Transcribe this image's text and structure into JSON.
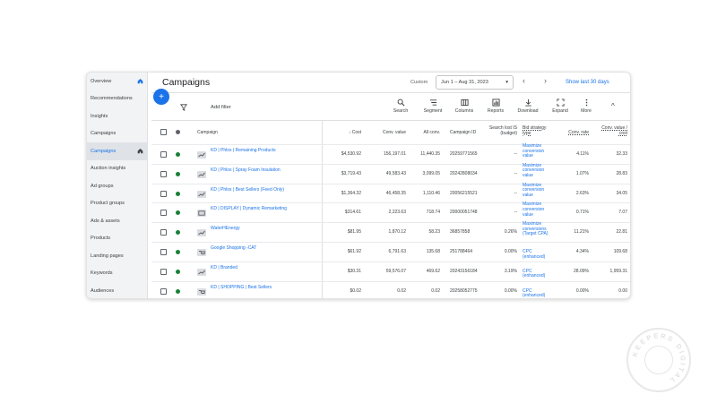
{
  "sidebar": {
    "items": [
      {
        "label": "Overview",
        "home": true,
        "active": false
      },
      {
        "label": "Recommendations",
        "home": false,
        "active": false
      },
      {
        "label": "Insights",
        "home": false,
        "active": false
      },
      {
        "label": "Campaigns",
        "home": false,
        "active": false
      },
      {
        "label": "Campaigns",
        "home": true,
        "active": true
      },
      {
        "label": "Auction insights",
        "home": false,
        "active": false
      },
      {
        "label": "Ad groups",
        "home": false,
        "active": false
      },
      {
        "label": "Product groups",
        "home": false,
        "active": false
      },
      {
        "label": "Ads & assets",
        "home": false,
        "active": false
      },
      {
        "label": "Products",
        "home": false,
        "active": false
      },
      {
        "label": "Landing pages",
        "home": false,
        "active": false
      },
      {
        "label": "Keywords",
        "home": false,
        "active": false
      },
      {
        "label": "Audiences",
        "home": false,
        "active": false
      }
    ]
  },
  "header": {
    "title": "Campaigns",
    "custom_label": "Custom",
    "date_range": "Jun 1 – Aug 31, 2023",
    "show_last": "Show last 30 days"
  },
  "toolbar": {
    "fab": "+",
    "add_filter": "Add filter",
    "tools": [
      {
        "label": "Search",
        "icon": "search-icon"
      },
      {
        "label": "Segment",
        "icon": "segment-icon"
      },
      {
        "label": "Columns",
        "icon": "columns-icon"
      },
      {
        "label": "Reports",
        "icon": "reports-icon"
      },
      {
        "label": "Download",
        "icon": "download-icon"
      },
      {
        "label": "Expand",
        "icon": "expand-icon"
      },
      {
        "label": "More",
        "icon": "more-icon"
      }
    ],
    "collapse": "^"
  },
  "table": {
    "headers": {
      "campaign": "Campaign",
      "cost": "↓ Cost",
      "conv_value": "Conv. value",
      "all_conv": "All conv.",
      "campaign_id": "Campaign ID",
      "search_lost_is": "Search lost IS (budget)",
      "bid_strategy": "Bid strategy type",
      "conv_rate": "Conv. rate",
      "conv_value_cost": "Conv. value / cost"
    },
    "rows": [
      {
        "campaign": "KD | Phlox | Remaining Products",
        "cost": "$4,530.92",
        "conv_value": "156,197.01",
        "all_conv": "11,440.35",
        "campaign_id": "20259771565",
        "search_lost_is": "--",
        "bid_strategy": "Maximize conversion value",
        "conv_rate": "4.11%",
        "conv_value_cost": "32.33",
        "icon": "search"
      },
      {
        "campaign": "KD | Phlox | Spray Foam Insulation",
        "cost": "$3,719.43",
        "conv_value": "49,583.43",
        "all_conv": "3,099.05",
        "campaign_id": "20242808034",
        "search_lost_is": "--",
        "bid_strategy": "Maximize conversion value",
        "conv_rate": "1.07%",
        "conv_value_cost": "28.83",
        "icon": "search"
      },
      {
        "campaign": "KD | Phlox | Best Sellers (Feed Only)",
        "cost": "$1,364.32",
        "conv_value": "46,458.35",
        "all_conv": "1,110.46",
        "campaign_id": "20056215521",
        "search_lost_is": "--",
        "bid_strategy": "Maximize conversion value",
        "conv_rate": "2.63%",
        "conv_value_cost": "34.05",
        "icon": "search"
      },
      {
        "campaign": "KD | DISPLAY | Dynamic Remarketing",
        "cost": "$314.61",
        "conv_value": "2,223.63",
        "all_conv": "718.74",
        "campaign_id": "20000051748",
        "search_lost_is": "--",
        "bid_strategy": "Maximize conversion value",
        "conv_rate": "0.71%",
        "conv_value_cost": "7.07",
        "icon": "display"
      },
      {
        "campaign": "WaterHEnergy",
        "cost": "$81.95",
        "conv_value": "1,870.12",
        "all_conv": "58.23",
        "campaign_id": "36857858",
        "search_lost_is": "0.26%",
        "bid_strategy": "Maximize conversions (Target CPA)",
        "conv_rate": "11.21%",
        "conv_value_cost": "22.81",
        "icon": "search"
      },
      {
        "campaign": "Google Shopping -CAT",
        "cost": "$61.92",
        "conv_value": "6,791.63",
        "all_conv": "135.68",
        "campaign_id": "251788464",
        "search_lost_is": "0.00%",
        "bid_strategy": "CPC (enhanced)",
        "conv_rate": "4.34%",
        "conv_value_cost": "109.68",
        "icon": "shopping"
      },
      {
        "campaign": "KD | Branded",
        "cost": "$30.31",
        "conv_value": "59,576.07",
        "all_conv": "469.62",
        "campaign_id": "20243156184",
        "search_lost_is": "3.19%",
        "bid_strategy": "CPC (enhanced)",
        "conv_rate": "28.09%",
        "conv_value_cost": "1,959.31",
        "icon": "search"
      },
      {
        "campaign": "KD | SHOPPING | Best Sellers",
        "cost": "$0.02",
        "conv_value": "0.02",
        "all_conv": "0.02",
        "campaign_id": "20258052775",
        "search_lost_is": "0.00%",
        "bid_strategy": "CPC (enhanced)",
        "conv_rate": "0.00%",
        "conv_value_cost": "0.00",
        "icon": "shopping"
      }
    ]
  },
  "watermark": {
    "text": "KEEPERS DIGITAL"
  },
  "colors": {
    "accent": "#1a73e8",
    "status_enabled": "#188038",
    "sidebar_bg": "#f1f3f4"
  }
}
